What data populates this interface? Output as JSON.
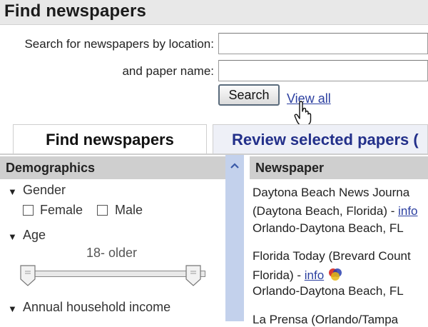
{
  "title": "Find newspapers",
  "search": {
    "location_label": "Search for newspapers by location:",
    "location_value": "",
    "name_label": "and paper name:",
    "name_value": "",
    "search_button": "Search",
    "view_all_link": "View all"
  },
  "tabs": [
    {
      "label": "Find newspapers",
      "active": true
    },
    {
      "label": "Review selected papers (",
      "active": false
    }
  ],
  "demographics": {
    "header": "Demographics",
    "gender": {
      "label": "Gender",
      "options": [
        "Female",
        "Male"
      ]
    },
    "age": {
      "label": "Age",
      "range_text": "18- older",
      "range_min_fraction": 0.0,
      "range_max_fraction": 1.0
    },
    "income": {
      "label": "Annual household income"
    }
  },
  "newspapers": {
    "header": "Newspaper",
    "items": [
      {
        "line1": "Daytona Beach News Journa",
        "line2_prefix": "(Daytona Beach, Florida) - ",
        "link": "info",
        "line3": "Orlando-Daytona Beach, FL"
      },
      {
        "line1": "Florida Today (Brevard Count",
        "line2_prefix": "Florida) - ",
        "link": "info",
        "line3": "Orlando-Daytona Beach, FL"
      },
      {
        "line1": "La Prensa (Orlando/Tampa",
        "line2_prefix": "",
        "link": "",
        "line3": ""
      }
    ]
  },
  "colors": {
    "link": "#2b3fa0",
    "tab_inactive_text": "#23308a",
    "scroll_column": "#c3d1ec",
    "header_gray": "#cfcfcf"
  }
}
